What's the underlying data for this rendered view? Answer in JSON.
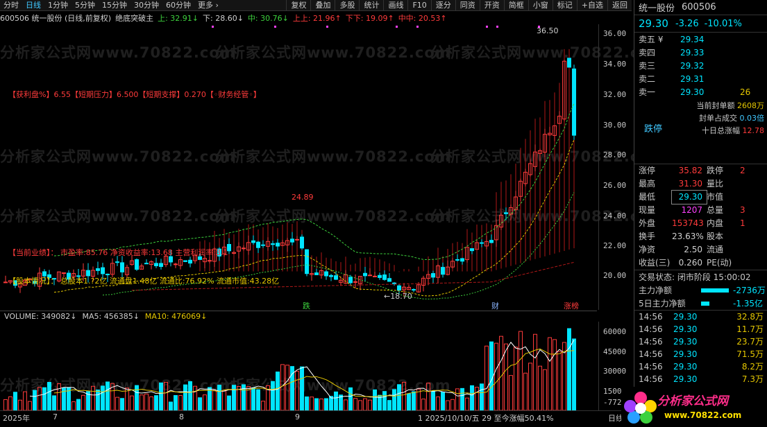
{
  "toolbar": {
    "tabs": [
      "分时",
      "日线",
      "1分钟",
      "5分钟",
      "15分钟",
      "30分钟",
      "60分钟",
      "更多 ›"
    ],
    "active_tab": "日线",
    "tools": [
      "复权",
      "叠加",
      "多股",
      "统计",
      "画线",
      "F10",
      "逐分",
      "同资",
      "开资",
      "简框",
      "小窗",
      "标记",
      "+自选",
      "返回"
    ]
  },
  "indicator_line": {
    "code_name": "600506 统一股份 (日线,前复权)",
    "formula": "绝底突破主",
    "upper": "上: 32.91↓",
    "lower": "下: 28.60↓",
    "mid": "中: 30.76↓",
    "upper_upper": "上上: 21.96↑",
    "lower_lower": "下下: 19.09↑",
    "mid_mid": "中中: 20.53↑"
  },
  "price_axis": [
    "36.00",
    "34.00",
    "32.00",
    "30.00",
    "28.00",
    "26.00",
    "24.00",
    "22.00",
    "20.00"
  ],
  "annotations": {
    "profit_line": "【获利盘%】6.55【短期压力】6.500【短期支撑】0.270【◦财务经管◦】",
    "performance": "【当前业绩】： 市盈率:85.76 净资收益率:13.68 主营利润率:3.1",
    "equity": "【股本情况】： 总股本1.?2亿 流通盘1.48亿 流通比:76.92% 流通市值:43.28亿",
    "high_mark": "36.50",
    "mid_high_mark": "24.89",
    "low_mark": "←18.70",
    "tag_die": "跌",
    "tag_cai": "财",
    "tag_zhang": "涨榜"
  },
  "volume": {
    "label": "VOLUME: 349082↓",
    "ma5": "MA5: 456385↓",
    "ma10": "MA10: 476069↓",
    "axis": [
      "60000",
      "45000",
      "30000",
      "15000",
      "-772"
    ]
  },
  "date_axis": {
    "year": "2025年",
    "m7": "7",
    "m8": "8",
    "m9": "9",
    "status": "1 2025/10/10/五 29 至今涨幅50.41%",
    "right": "日线"
  },
  "watermark": "分析家公式网www.70822.com",
  "right_panel": {
    "name": "统一股份",
    "code": "600506",
    "price": "29.30",
    "change": "-3.26",
    "pct": "-10.01%",
    "asks": [
      {
        "label": "卖五 ¥",
        "price": "29.34",
        "extra": ""
      },
      {
        "label": "卖四",
        "price": "29.33",
        "extra": ""
      },
      {
        "label": "卖三",
        "price": "29.32",
        "extra": ""
      },
      {
        "label": "卖二",
        "price": "29.31",
        "extra": ""
      },
      {
        "label": "卖一",
        "price": "29.30",
        "extra": "26"
      }
    ],
    "limit_info": [
      {
        "label": "当前封单额",
        "value": "2608万"
      },
      {
        "label": "封单占成交",
        "value": "0.03倍"
      },
      {
        "label": "十日总涨幅",
        "value": "12.78"
      }
    ],
    "status_word": "跌停",
    "stats": [
      [
        "涨停",
        "35.82",
        "跌停",
        "2"
      ],
      [
        "最高",
        "31.30",
        "量比",
        ""
      ],
      [
        "最低",
        "29.30",
        "市值",
        ""
      ],
      [
        "现量",
        "1207",
        "总量",
        "3"
      ],
      [
        "外盘",
        "153743",
        "内盘",
        "1"
      ],
      [
        "换手",
        "23.63%",
        "股本",
        ""
      ],
      [
        "净资",
        "2.50",
        "流通",
        ""
      ],
      [
        "收益(三)",
        "0.260",
        "PE(动)",
        ""
      ]
    ],
    "trade_state": "交易状态: 闭市阶段 15:00:02",
    "main_flow": {
      "label": "主力净额",
      "value": "-2736万"
    },
    "main_flow5": {
      "label": "5日主力净额",
      "value": "-1.35亿"
    },
    "ticks": [
      {
        "time": "14:56",
        "price": "29.30",
        "vol": "32.8万"
      },
      {
        "time": "14:56",
        "price": "29.30",
        "vol": "11.7万"
      },
      {
        "time": "14:56",
        "price": "29.30",
        "vol": "23.7万"
      },
      {
        "time": "14:56",
        "price": "29.30",
        "vol": "71.5万"
      },
      {
        "time": "14:56",
        "price": "29.30",
        "vol": "8.2万"
      },
      {
        "time": "14:56",
        "price": "29.30",
        "vol": "7.3万"
      }
    ]
  },
  "logo": {
    "text": "分析家公式网",
    "url": "www.70822.com"
  },
  "colors": {
    "up": "#ff3b3b",
    "down": "#00e5ff",
    "ma_yellow": "#e6c800",
    "ma_white": "#ffffff",
    "green_dash": "#3dd13d"
  }
}
